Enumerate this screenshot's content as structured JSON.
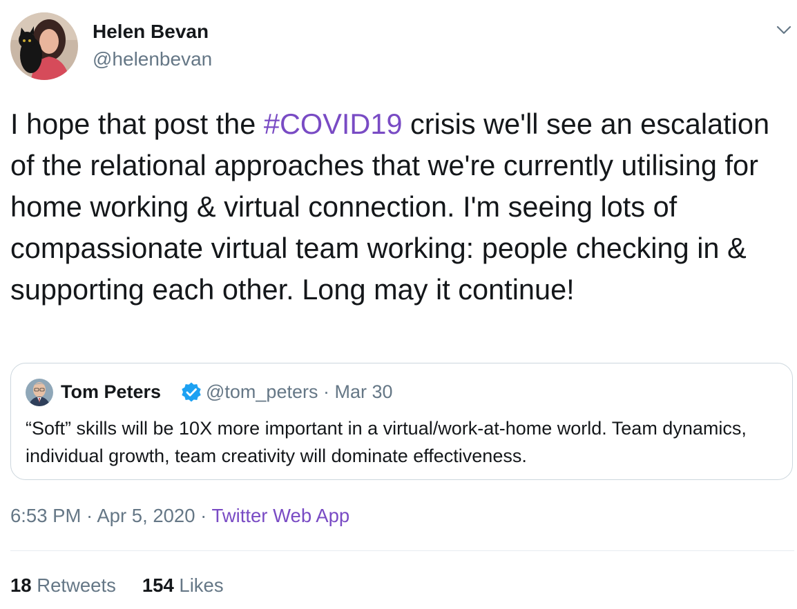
{
  "author": {
    "name": "Helen Bevan",
    "handle": "@helenbevan",
    "avatar_icon": "profile-photo-with-black-cat"
  },
  "menu_icon": "chevron-down-icon",
  "tweet": {
    "text_before": "I hope that post the ",
    "hashtag": "#COVID19",
    "text_after": " crisis we'll see an escalation of the relational approaches that we're currently utilising for home working & virtual connection. I'm seeing lots of compassionate virtual team working: people checking in & supporting each other. Long may it continue!"
  },
  "quote": {
    "name": "Tom Peters",
    "verified_icon": "verified-badge-icon",
    "handle_date": "@tom_peters · Mar 30",
    "text": "“Soft” skills will be 10X more important in a virtual/work-at-home world. Team dynamics, individual growth, team creativity will dominate effectiveness."
  },
  "meta": {
    "time_date": "6:53 PM · Apr 5, 2020 · ",
    "source": "Twitter Web App"
  },
  "stats": {
    "retweets_count": "18",
    "retweets_label": "Retweets",
    "likes_count": "154",
    "likes_label": "Likes"
  },
  "colors": {
    "text": "#14171a",
    "secondary": "#657786",
    "link": "#794bc4",
    "verified": "#1da1f2",
    "border": "#ccd6dd"
  }
}
